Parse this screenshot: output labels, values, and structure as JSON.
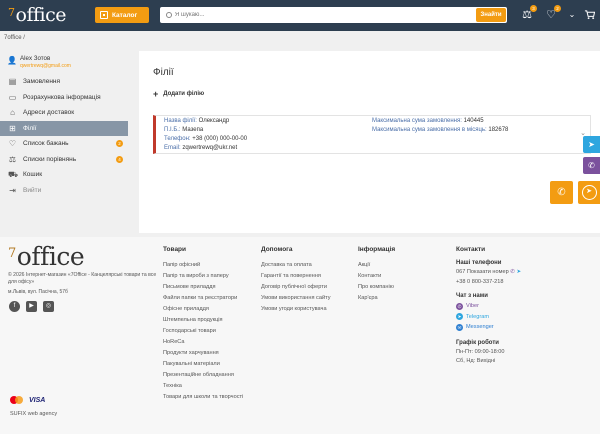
{
  "header": {
    "logo_sup": "7",
    "logo_text": "office",
    "catalog_label": "Каталог",
    "search_placeholder": "Я шукаю...",
    "search_button": "Знайти",
    "compare_count": "3",
    "wishlist_count": "2",
    "icons": [
      "grid-icon",
      "search-icon",
      "scales-icon",
      "heart-icon",
      "chevron-down-icon",
      "cart-icon"
    ]
  },
  "breadcrumb": "7office /",
  "sidebar": {
    "user_name": "Alex Зотов",
    "user_email": "qwertrewq@gmail.com",
    "items": [
      {
        "label": "Замовлення",
        "icon": "orders-icon"
      },
      {
        "label": "Розрахункова інформація",
        "icon": "card-icon"
      },
      {
        "label": "Адреси доставок",
        "icon": "pin-icon"
      },
      {
        "label": "Філії",
        "icon": "branch-icon"
      },
      {
        "label": "Список бажань",
        "icon": "heart-icon",
        "badge": "2"
      },
      {
        "label": "Списки порівнянь",
        "icon": "scales-icon",
        "badge": "4"
      },
      {
        "label": "Кошик",
        "icon": "cart-icon"
      },
      {
        "label": "Вийти",
        "icon": "logout-icon"
      }
    ]
  },
  "main": {
    "title": "Філії",
    "add_branch": "Додати філію",
    "branch": {
      "name_label": "Назва філії:",
      "name_value": "Олександр",
      "pib_label": "П.І.Б.:",
      "pib_value": "Мазепа",
      "phone_label": "Телефон:",
      "phone_value": "+38 (000) 000-00-00",
      "email_label": "Email:",
      "email_value": "zqwertrewq@ukr.net",
      "max_order_label": "Максимальна сума замовлення:",
      "max_order_value": "140445",
      "max_month_label": "Максимальна сума замовлення в місяць:",
      "max_month_value": "182678"
    }
  },
  "footer": {
    "logo_sup": "7",
    "logo_text": "office",
    "copyright": "© 2026 Інтернет-магазин «7Office - Канцелярські товари та все для офісу»",
    "address": "м.Львів, вул. Пасічна, 57б",
    "payments": [
      "mastercard-icon",
      "VISA"
    ],
    "agency": "SUFIX web agency",
    "products": {
      "title": "Товари",
      "links": [
        "Папір офісний",
        "Папір та вироби з паперу",
        "Письмове приладдя",
        "Файли папки та реєстратори",
        "Офісне приладдя",
        "Штемпельна продукція",
        "Господарські товари",
        "HoReCa",
        "Продукти харчування",
        "Пакувальні матеріали",
        "Презентаційне обладнання",
        "Техніка",
        "Товари для школи та творчості"
      ]
    },
    "help": {
      "title": "Допомога",
      "links": [
        "Доставка та оплата",
        "Гарантії та повернення",
        "Договір публічної оферти",
        "Умови використання сайту",
        "Умови угоди користувача"
      ]
    },
    "info": {
      "title": "Інформація",
      "links": [
        "Акції",
        "Контакти",
        "Про компанію",
        "Кар'єра"
      ]
    },
    "contacts": {
      "title": "Контакти",
      "phones_title": "Наші телефони",
      "phone1": "067 Показати номер",
      "phone2": "+38 0 800-337-218",
      "chat_title": "Чат з нами",
      "viber": "Viber",
      "telegram": "Telegram",
      "messenger": "Messenger",
      "hours_title": "Графік роботи",
      "hours1": "Пн-Пт: 09:00-18:00",
      "hours2": "Сб, Нд: Вихідні"
    }
  },
  "colors": {
    "accent": "#f39c12",
    "header_bg": "#2d3e50",
    "active_item": "#8796a6",
    "branch_border": "#c0392b"
  }
}
